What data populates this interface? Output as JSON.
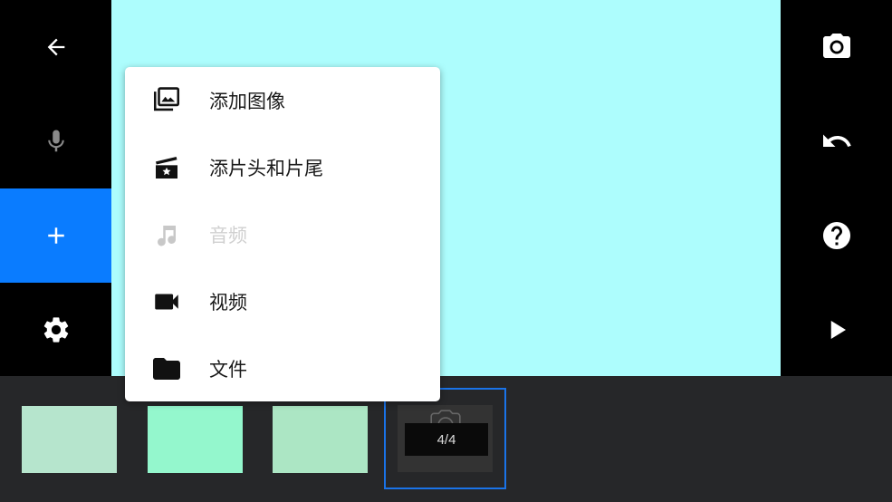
{
  "colors": {
    "preview_bg": "#adfdfd",
    "accent": "#0a7cff",
    "selected_border": "#1a73e8",
    "thumb1": "#b6e5cd",
    "thumb2": "#94f7cd",
    "thumb3": "#ace6c4"
  },
  "left_toolbar": [
    {
      "icon": "arrow-back-icon"
    },
    {
      "icon": "microphone-icon"
    },
    {
      "icon": "plus-icon",
      "active": true
    },
    {
      "icon": "gear-icon"
    }
  ],
  "right_toolbar": [
    {
      "icon": "camera-icon"
    },
    {
      "icon": "undo-icon"
    },
    {
      "icon": "help-icon"
    },
    {
      "icon": "play-icon"
    }
  ],
  "add_menu": {
    "items": [
      {
        "label": "添加图像",
        "icon": "images-icon",
        "enabled": true
      },
      {
        "label": "添片头和片尾",
        "icon": "title-card-icon",
        "enabled": true
      },
      {
        "label": "音频",
        "icon": "music-note-icon",
        "enabled": false
      },
      {
        "label": "视频",
        "icon": "video-camera-icon",
        "enabled": true
      },
      {
        "label": "文件",
        "icon": "folder-icon",
        "enabled": true
      }
    ]
  },
  "timeline": {
    "slide_counter": "4/4"
  }
}
